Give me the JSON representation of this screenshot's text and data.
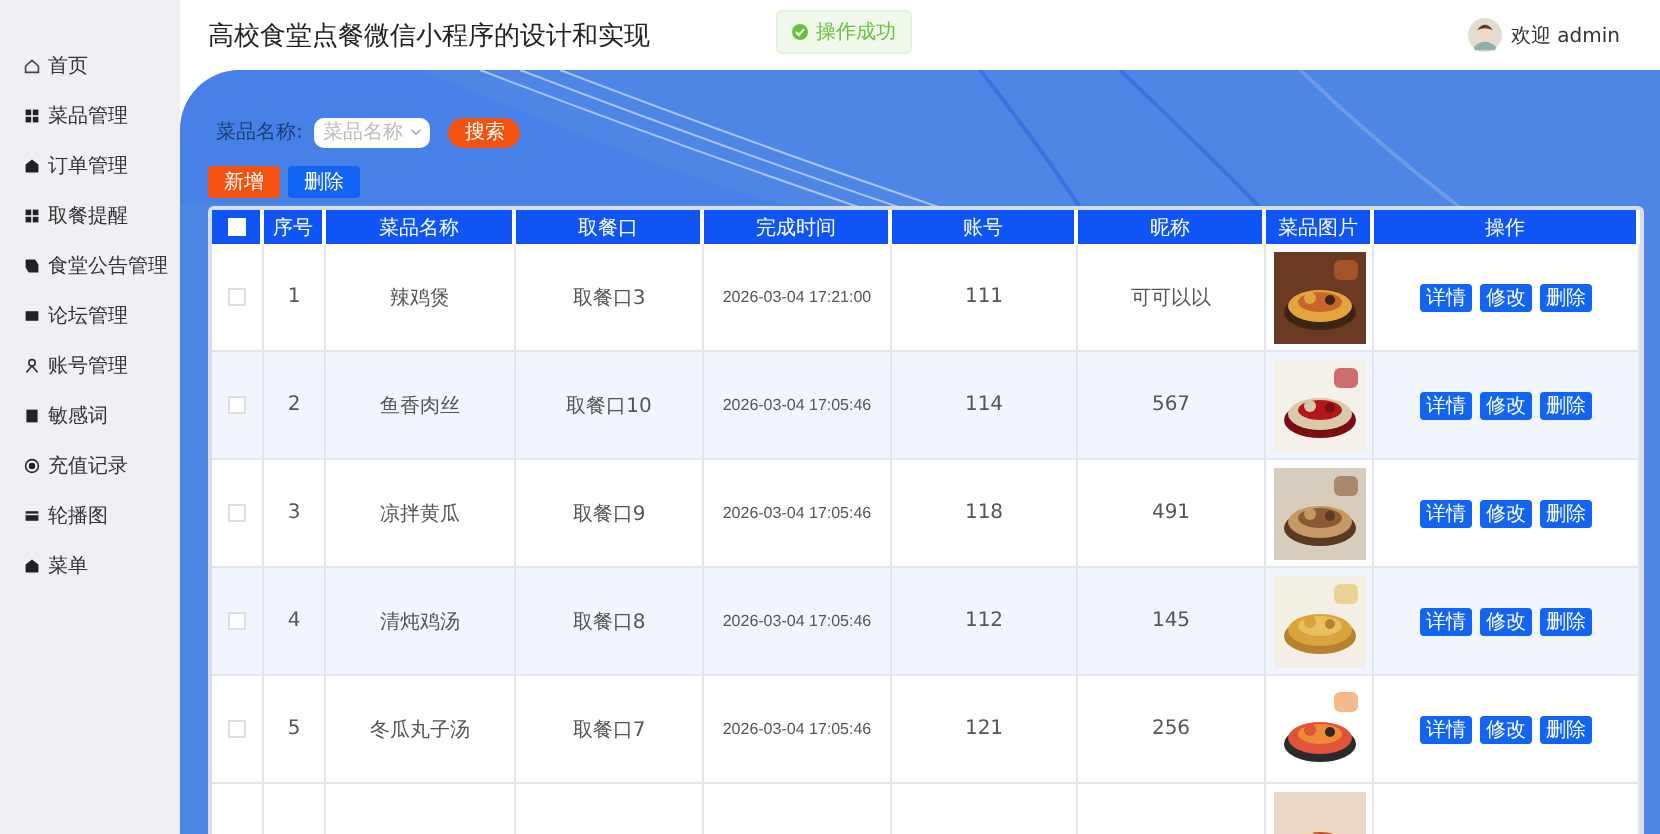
{
  "sidebar": {
    "items": [
      {
        "label": "首页",
        "selected": false
      },
      {
        "label": "菜品管理",
        "selected": false
      },
      {
        "label": "订单管理",
        "selected": false
      },
      {
        "label": "取餐提醒",
        "selected": false
      },
      {
        "label": "食堂公告管理",
        "selected": false
      },
      {
        "label": "论坛管理",
        "selected": false
      },
      {
        "label": "账号管理",
        "selected": false
      },
      {
        "label": "敏感词",
        "selected": false
      },
      {
        "label": "充值记录",
        "selected": false
      },
      {
        "label": "轮播图",
        "selected": false
      },
      {
        "label": "菜单",
        "selected": false
      }
    ]
  },
  "header": {
    "title": "高校食堂点餐微信小程序的设计和实现",
    "toast": "操作成功",
    "welcome": "欢迎 admin"
  },
  "search": {
    "label": "菜品名称:",
    "placeholder": "菜品名称",
    "button": "搜索"
  },
  "actions": [
    {
      "label": "新增",
      "kind": "primary"
    },
    {
      "label": "删除",
      "kind": "secondary"
    }
  ],
  "table": {
    "select_all_checked": false,
    "columns": [
      "序号",
      "菜品名称",
      "取餐口",
      "完成时间",
      "账号",
      "昵称",
      "菜品图片",
      "操作"
    ],
    "rows": [
      {
        "checked": false,
        "cells": [
          "1",
          "辣鸡煲",
          "取餐口3",
          "2026-03-04 17:21:00",
          "111",
          "可可以以"
        ],
        "buttons": [
          "详情",
          "修改",
          "删除"
        ]
      },
      {
        "checked": false,
        "cells": [
          "2",
          "鱼香肉丝",
          "取餐口10",
          "2026-03-04 17:05:46",
          "114",
          "567"
        ],
        "buttons": [
          "详情",
          "修改",
          "删除"
        ]
      },
      {
        "checked": false,
        "cells": [
          "3",
          "凉拌黄瓜",
          "取餐口9",
          "2026-03-04 17:05:46",
          "118",
          "491"
        ],
        "buttons": [
          "详情",
          "修改",
          "删除"
        ]
      },
      {
        "checked": false,
        "cells": [
          "4",
          "清炖鸡汤",
          "取餐口8",
          "2026-03-04 17:05:46",
          "112",
          "145"
        ],
        "buttons": [
          "详情",
          "修改",
          "删除"
        ]
      },
      {
        "checked": false,
        "cells": [
          "5",
          "冬瓜丸子汤",
          "取餐口7",
          "2026-03-04 17:05:46",
          "121",
          "256"
        ],
        "buttons": [
          "详情",
          "修改",
          "删除"
        ]
      }
    ]
  }
}
